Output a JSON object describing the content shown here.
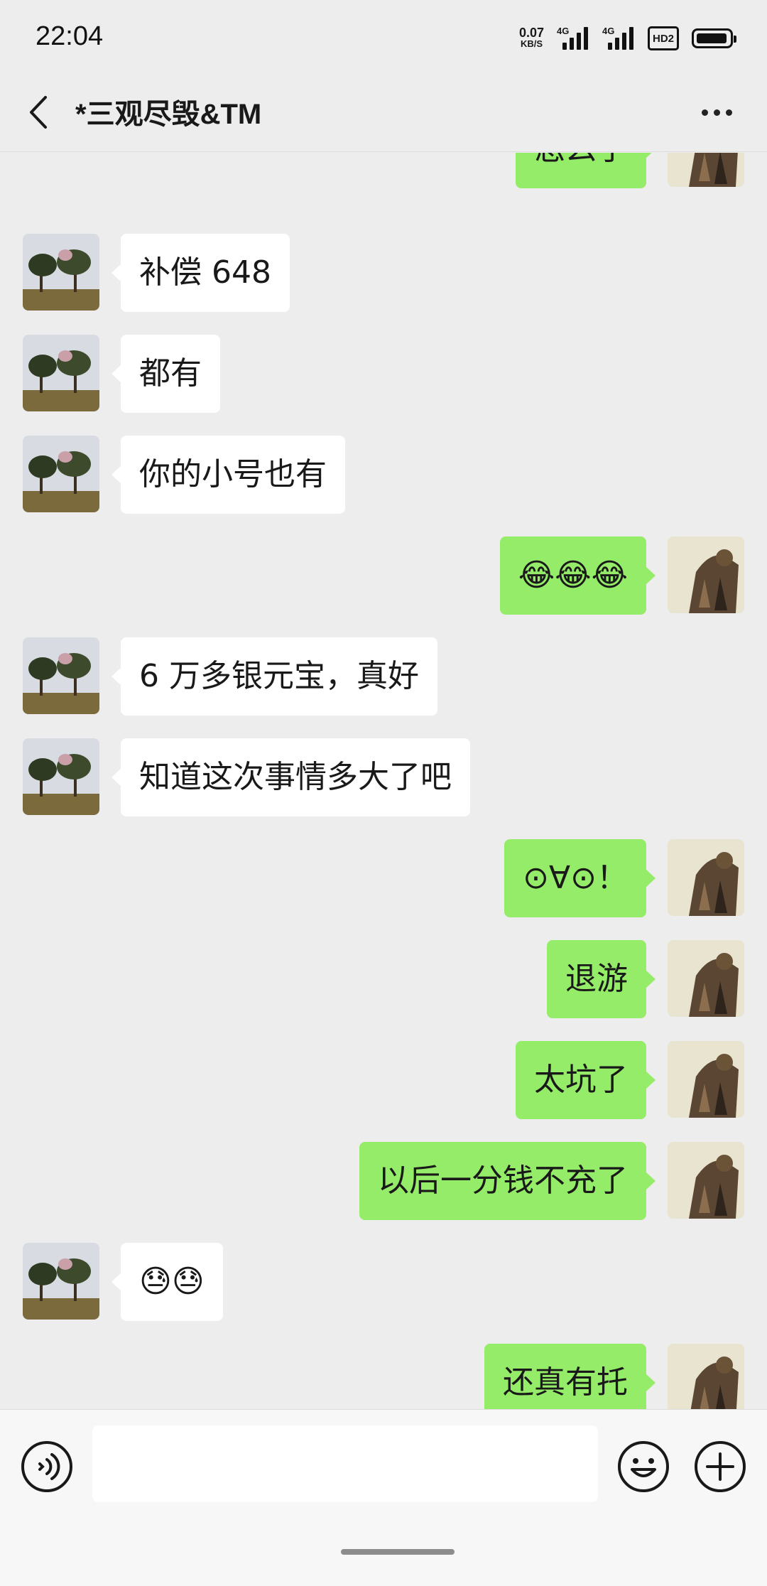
{
  "status_bar": {
    "time": "22:04",
    "net_speed_value": "0.07",
    "net_speed_unit": "KB/S",
    "signal_1": "4G",
    "signal_2": "4G",
    "hd_label": "HD2"
  },
  "header": {
    "title": "*三观尽毁&TM",
    "back_icon": "chevron-left-icon",
    "more_icon": "more-horizontal-icon"
  },
  "messages": [
    {
      "side": "right",
      "text": "怎么了"
    },
    {
      "side": "left",
      "text": "补偿 648"
    },
    {
      "side": "left",
      "text": "都有"
    },
    {
      "side": "left",
      "text": "你的小号也有"
    },
    {
      "side": "right",
      "text": "😂😂😂"
    },
    {
      "side": "left",
      "text": "6 万多银元宝，真好"
    },
    {
      "side": "left",
      "text": "知道这次事情多大了吧"
    },
    {
      "side": "right",
      "text": "⊙∀⊙！"
    },
    {
      "side": "right",
      "text": "退游"
    },
    {
      "side": "right",
      "text": "太坑了"
    },
    {
      "side": "right",
      "text": "以后一分钱不充了"
    },
    {
      "side": "left",
      "text": "😓😓"
    },
    {
      "side": "right",
      "text": "还真有托"
    }
  ],
  "input_bar": {
    "voice_icon": "voice-icon",
    "input_value": "",
    "emoji_icon": "emoji-icon",
    "plus_icon": "plus-icon"
  },
  "colors": {
    "background": "#ededed",
    "sent_bubble": "#95ec69",
    "received_bubble": "#ffffff"
  }
}
